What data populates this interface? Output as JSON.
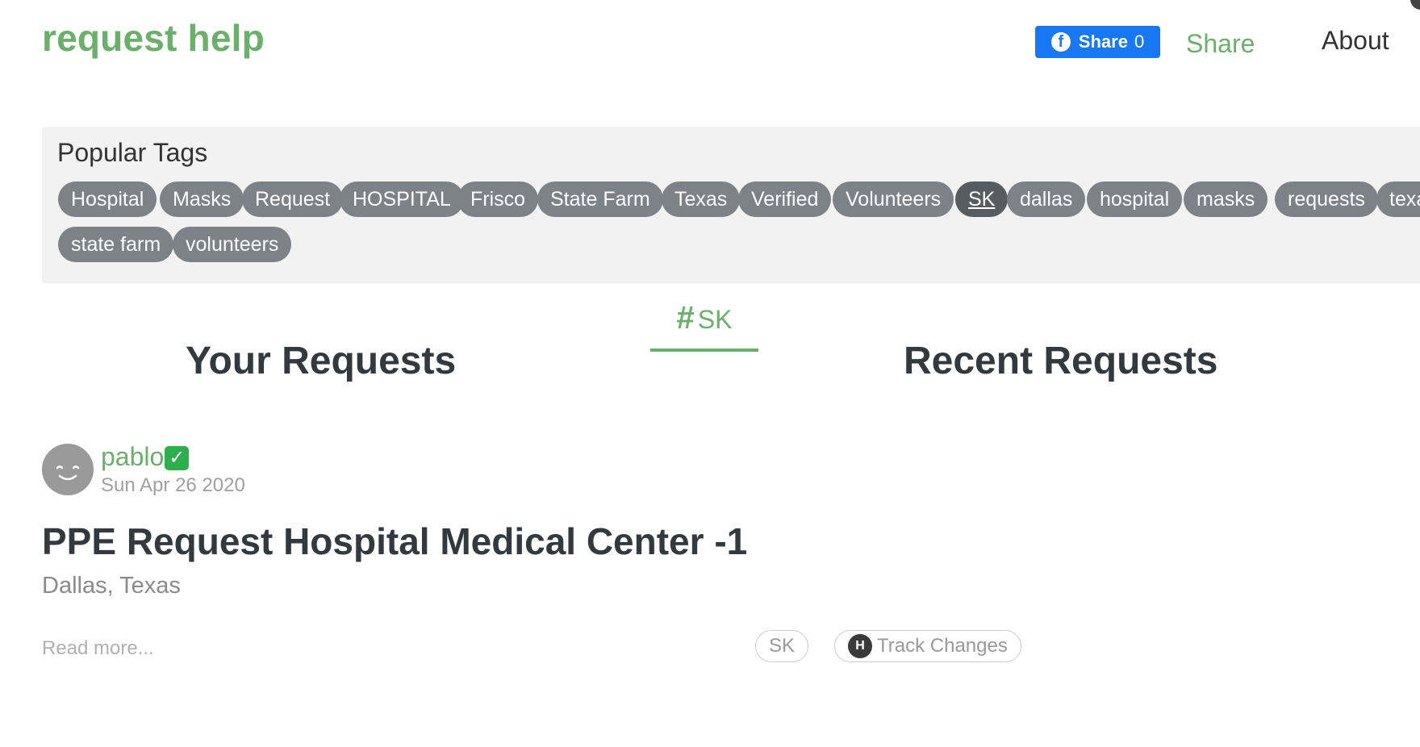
{
  "header": {
    "logo": "request help",
    "fb_share_label": "Share",
    "fb_share_count": "0",
    "share_link": "Share",
    "about_link": "About"
  },
  "tags": {
    "title": "Popular Tags",
    "items": [
      {
        "label": "Hospital"
      },
      {
        "label": "Masks"
      },
      {
        "label": "Request"
      },
      {
        "label": "HOSPITAL"
      },
      {
        "label": "Frisco"
      },
      {
        "label": "State Farm"
      },
      {
        "label": "Texas"
      },
      {
        "label": "Verified"
      },
      {
        "label": "Volunteers"
      },
      {
        "label": "SK",
        "active": true
      },
      {
        "label": "dallas"
      },
      {
        "label": "hospital"
      },
      {
        "label": "masks"
      },
      {
        "label": "requests"
      },
      {
        "label": "texa"
      },
      {
        "label": "state farm"
      },
      {
        "label": "volunteers"
      }
    ]
  },
  "hashtag": {
    "symbol": "#",
    "label": "SK"
  },
  "sections": {
    "your_requests": "Your Requests",
    "recent_requests": "Recent Requests"
  },
  "request": {
    "author": "pablo",
    "check": "✓",
    "date": "Sun Apr 26 2020",
    "title": "PPE Request Hospital Medical Center -1",
    "location": "Dallas, Texas",
    "read_more": "Read more...",
    "tag_chip": "SK",
    "track_icon_letter": "H",
    "track_label": "Track Changes"
  },
  "colors": {
    "brand_green": "#6ab06a",
    "facebook_blue": "#1877f2",
    "tag_gray": "#7c8288",
    "check_green": "#2db04b"
  }
}
